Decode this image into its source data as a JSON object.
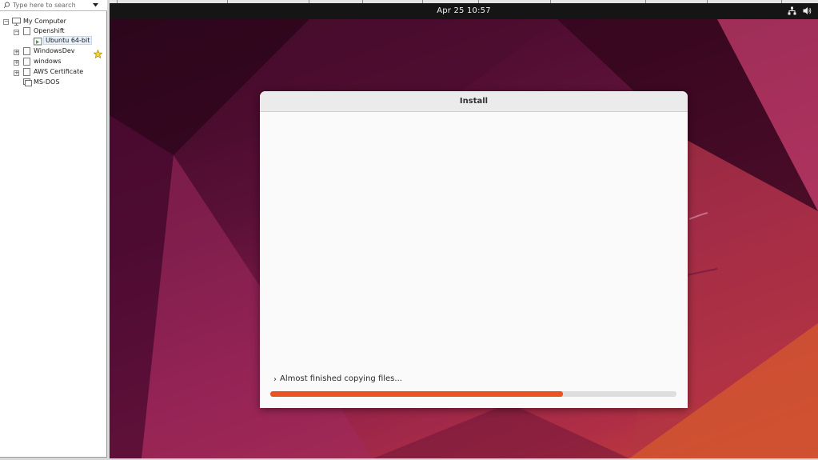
{
  "library": {
    "search_placeholder": "Type here to search",
    "tree": {
      "root": "My Computer",
      "items": [
        "Openshift",
        "Ubuntu 64-bit",
        "WindowsDev",
        "windows",
        "AWS Certificate",
        "MS-DOS"
      ]
    }
  },
  "vm": {
    "topbar": {
      "clock": "Apr 25  10:57"
    },
    "installer": {
      "title": "Install",
      "status": "Almost finished copying files...",
      "progress_fraction": 0.72,
      "accent": "#e95420"
    }
  }
}
